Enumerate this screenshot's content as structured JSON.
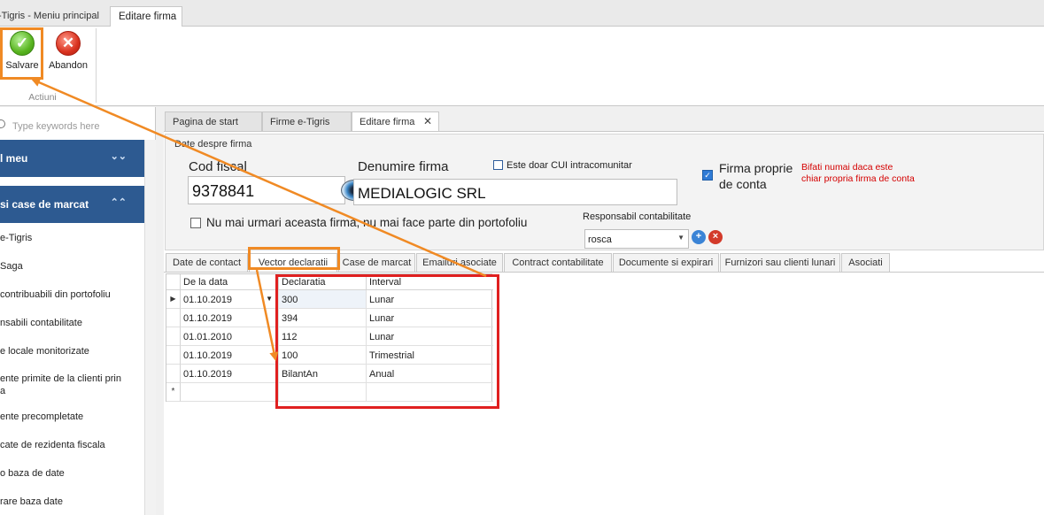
{
  "window": {
    "app_title": "-Tigris  - Meniu principal",
    "active_tab": "Editare firma"
  },
  "ribbon": {
    "save_label": "Salvare",
    "abandon_label": "Abandon",
    "group_label": "Actiuni"
  },
  "sidebar": {
    "search_placeholder": "Type keywords here",
    "groups": [
      "l meu",
      "si case de marcat"
    ],
    "items": [
      "e-Tigris",
      "Saga",
      "contribuabili din portofoliu",
      "nsabili contabilitate",
      "e locale monitorizate",
      "ente primite de la clienti prin",
      "a",
      "ente precompletate",
      "cate de rezidenta fiscala",
      "o baza de date",
      "rare baza date"
    ]
  },
  "doc_tabs": [
    "Pagina de start",
    "Firme e-Tigris",
    "Editare firma"
  ],
  "form": {
    "section_title": "Date despre firma",
    "cod_fiscal_label": "Cod fiscal",
    "cod_fiscal_value": "9378841",
    "denumire_label": "Denumire firma",
    "denumire_value": "MEDIALOGIC SRL",
    "intracom_label": "Este doar CUI intracomunitar",
    "firma_proprie_label_1": "Firma proprie",
    "firma_proprie_label_2": "de conta",
    "hint_1": "Bifati numai daca este",
    "hint_2": "chiar propria firma de conta",
    "nu_mai_urmari_label": "Nu mai urmari aceasta firma, nu mai face parte din portofoliu",
    "responsabil_label": "Responsabil contabilitate",
    "responsabil_value": "rosca"
  },
  "sub_tabs": [
    "Date de contact",
    "Vector declaratii",
    "Case de marcat",
    "Emailuri asociate",
    "Contract contabilitate",
    "Documente si expirari",
    "Furnizori sau clienti lunari",
    "Asociati"
  ],
  "grid": {
    "headers": [
      "De la data",
      "Declaratia",
      "Interval"
    ],
    "rows": [
      [
        "01.10.2019",
        "300",
        "Lunar"
      ],
      [
        "01.10.2019",
        "394",
        "Lunar"
      ],
      [
        "01.01.2010",
        "112",
        "Lunar"
      ],
      [
        "01.10.2019",
        "100",
        "Trimestrial"
      ],
      [
        "01.10.2019",
        "BilantAn",
        "Anual"
      ]
    ],
    "new_row_marker": "*"
  },
  "colors": {
    "annotation_orange": "#f08a24",
    "annotation_red": "#e02020",
    "nav_group": "#2d5a91"
  }
}
